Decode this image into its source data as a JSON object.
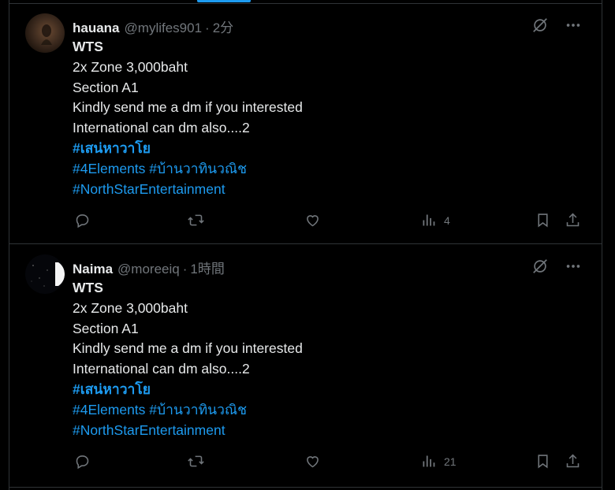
{
  "tweets": [
    {
      "name": "hauana",
      "handle": "@mylifes901",
      "separator": "·",
      "time": "2分",
      "title": "WTS",
      "lines": [
        "2x Zone 3,000baht",
        "Section A1",
        "Kindly send me a dm if you interested",
        "International can dm also....2"
      ],
      "hashtag_bold": "#เสน่หาวาโย",
      "hashtags_row": [
        "#4Elements",
        "#บ้านวาทินวณิช"
      ],
      "hashtag_last": "#NorthStarEntertainment",
      "views": "4"
    },
    {
      "name": "Naima",
      "handle": "@moreeiq",
      "separator": "·",
      "time": "1時間",
      "title": "WTS",
      "lines": [
        "2x Zone 3,000baht",
        "Section A1",
        "Kindly send me a dm if you interested",
        "International can dm also....2"
      ],
      "hashtag_bold": "#เสน่หาวาโย",
      "hashtags_row": [
        "#4Elements",
        "#บ้านวาทินวณิช"
      ],
      "hashtag_last": "#NorthStarEntertainment",
      "views": "21"
    }
  ],
  "icons": [
    "grok-icon",
    "more-icon",
    "reply-icon",
    "retweet-icon",
    "like-icon",
    "views-icon",
    "bookmark-icon",
    "share-icon"
  ],
  "colors": {
    "background": "#000000",
    "text": "#e7e9ea",
    "muted": "#71767b",
    "accent": "#1d9bf0",
    "border": "#2f3336"
  }
}
